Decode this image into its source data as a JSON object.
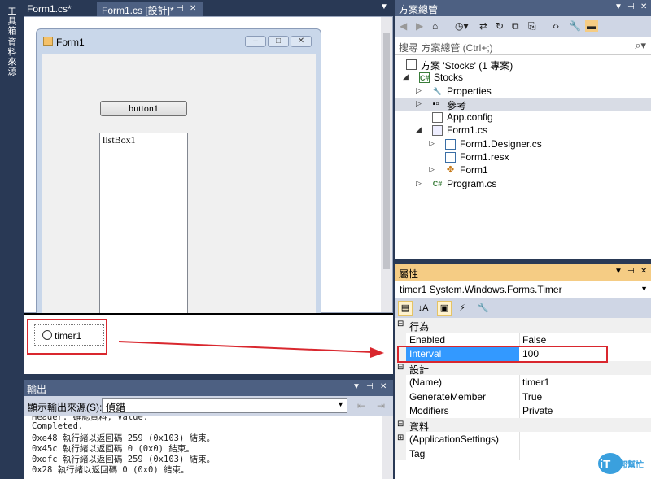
{
  "left_strip": {
    "toolbox": "工具箱",
    "datasource": "資料來源"
  },
  "tabs": [
    {
      "label": "Form1.cs*"
    },
    {
      "label": "Form1.cs [設計]*"
    }
  ],
  "designer": {
    "form_title": "Form1",
    "button_label": "button1",
    "listbox_label": "listBox1",
    "timer_label": "timer1"
  },
  "output": {
    "title": "輸出",
    "source_label": "顯示輸出來源(S):",
    "source_value": "偵錯",
    "lines": [
      "Header: 確認資料, Value.",
      "Completed.",
      "0xe48 執行緒以返回碼 259 (0x103) 結束。",
      "0x45c 執行緒以返回碼 0 (0x0) 結束。",
      "0xdfc 執行緒以返回碼 259 (0x103) 結束。",
      "0x28 執行緒以返回碼 0 (0x0) 結束。"
    ]
  },
  "solution": {
    "title": "方案總管",
    "search_placeholder": "搜尋 方案總管 (Ctrl+;)",
    "nodes": [
      {
        "label": "方案 'Stocks' (1 專案)"
      },
      {
        "label": "Stocks"
      },
      {
        "label": "Properties"
      },
      {
        "label": "參考"
      },
      {
        "label": "App.config"
      },
      {
        "label": "Form1.cs"
      },
      {
        "label": "Form1.Designer.cs"
      },
      {
        "label": "Form1.resx"
      },
      {
        "label": "Form1"
      },
      {
        "label": "Program.cs"
      }
    ]
  },
  "properties": {
    "title": "屬性",
    "object": "timer1  System.Windows.Forms.Timer",
    "categories": [
      {
        "name": "行為",
        "rows": [
          {
            "name": "Enabled",
            "value": "False"
          },
          {
            "name": "Interval",
            "value": "100"
          }
        ]
      },
      {
        "name": "設計",
        "rows": [
          {
            "name": "(Name)",
            "value": "timer1"
          },
          {
            "name": "GenerateMember",
            "value": "True"
          },
          {
            "name": "Modifiers",
            "value": "Private"
          }
        ]
      },
      {
        "name": "資料",
        "rows": [
          {
            "name": "(ApplicationSettings)",
            "value": ""
          },
          {
            "name": "Tag",
            "value": ""
          }
        ]
      }
    ]
  },
  "watermark": {
    "text": "iT邦幫忙"
  },
  "colors": {
    "annotation_red": "#d9272e",
    "titlebar_blue": "#4d6082",
    "properties_header": "#f5cc84",
    "selection_blue": "#3399ff"
  }
}
